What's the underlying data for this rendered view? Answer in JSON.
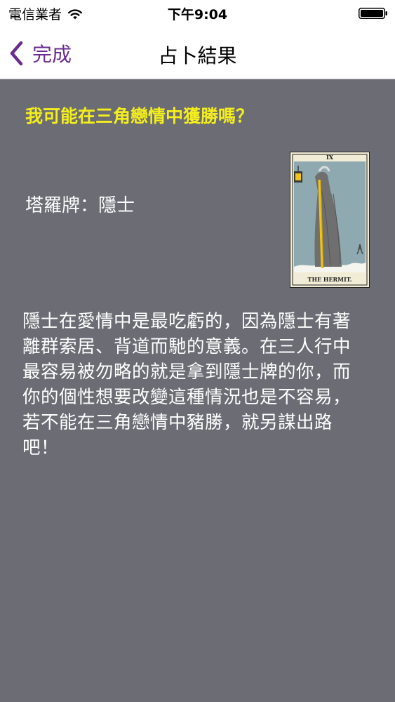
{
  "status_bar": {
    "carrier": "電信業者",
    "time": "下午9:04"
  },
  "nav": {
    "back_label": "完成",
    "title": "占卜結果"
  },
  "content": {
    "question": "我可能在三角戀情中獲勝嗎？",
    "card_name": "塔羅牌：隱士",
    "card_numeral": "IX",
    "card_caption": "THE HERMIT.",
    "reading": "隱士在愛情中是最吃虧的，因為隱士有著離群索居、背道而馳的意義。在三人行中最容易被勿略的就是拿到隱士牌的你，而你的個性想要改變這種情況也是不容易，若不能在三角戀情中豬勝，就另謀出路吧！"
  },
  "colors": {
    "background": "#6b6c74",
    "accent": "#6b2c91",
    "question": "#f4ee1c",
    "text": "#ffffff"
  },
  "icons": {
    "back": "chevron-left-icon",
    "wifi": "wifi-icon",
    "battery": "battery-icon"
  }
}
